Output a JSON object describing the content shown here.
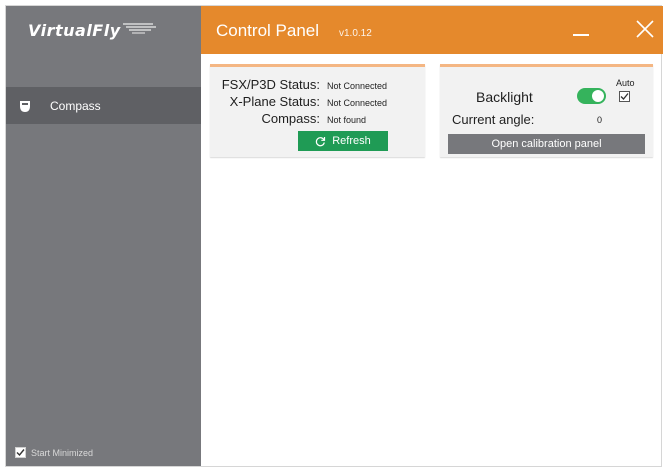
{
  "brand": {
    "name": "VirtualFly",
    "icon": "wing-icon"
  },
  "sidebar": {
    "items": [
      {
        "label": "Compass",
        "icon": "compass-device-icon"
      }
    ],
    "start_minimized": {
      "label": "Start Minimized",
      "checked": true
    }
  },
  "header": {
    "title": "Control Panel",
    "version": "v1.0.12",
    "minimize_icon": "minimize-icon",
    "close_icon": "close-icon"
  },
  "status_card": {
    "rows": [
      {
        "label": "FSX/P3D Status:",
        "value": "Not Connected"
      },
      {
        "label": "X-Plane Status:",
        "value": "Not Connected"
      },
      {
        "label": "Compass:",
        "value": "Not found"
      }
    ],
    "refresh_label": "Refresh",
    "refresh_icon": "refresh-icon"
  },
  "backlight_card": {
    "backlight_label": "Backlight",
    "backlight_on": true,
    "auto_label": "Auto",
    "auto_checked": true,
    "angle_label": "Current angle:",
    "angle_value": "0",
    "calibration_label": "Open calibration panel"
  },
  "colors": {
    "header": "#e5892c",
    "sidebar": "#77787c",
    "sidebar_active": "#5f6064",
    "refresh": "#1f9b55",
    "toggle_on": "#35b35c",
    "card_accent": "#f4b683"
  }
}
